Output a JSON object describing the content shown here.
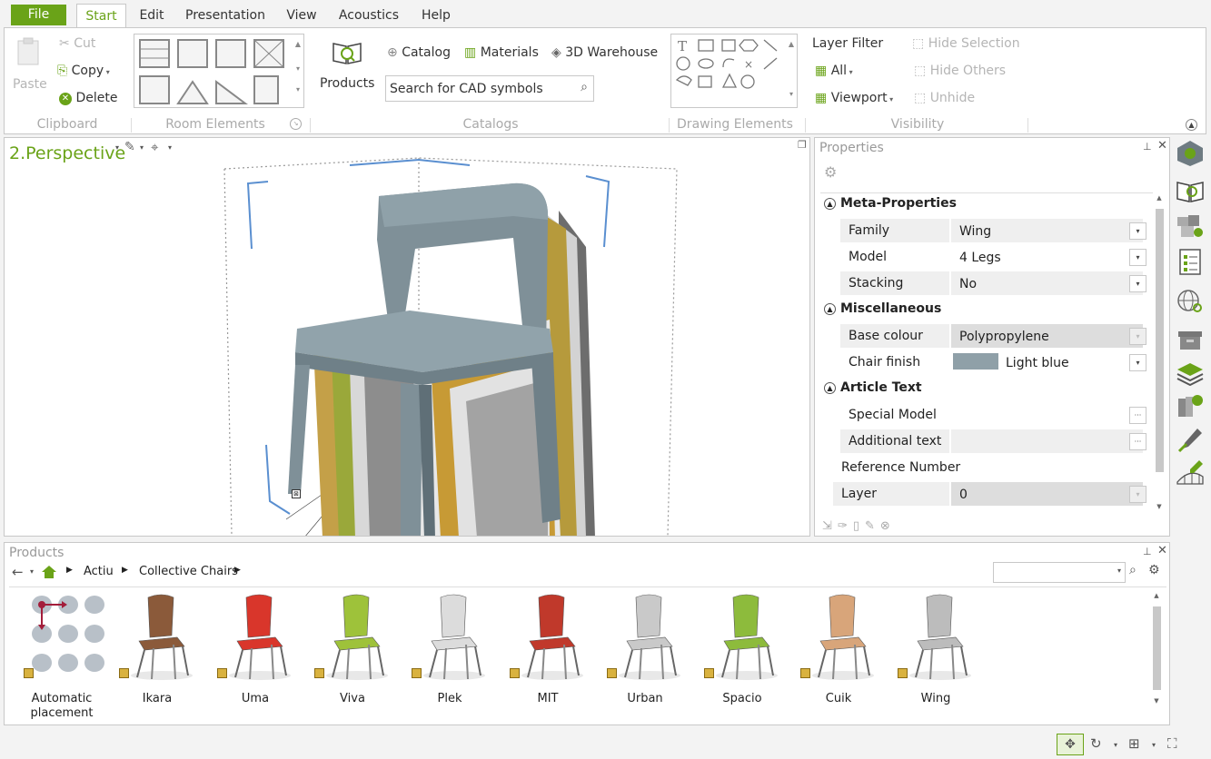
{
  "menu": {
    "file": "File",
    "tabs": [
      "Start",
      "Edit",
      "Presentation",
      "View",
      "Acoustics",
      "Help"
    ]
  },
  "ribbon": {
    "clipboard": {
      "paste": "Paste",
      "cut": "Cut",
      "copy": "Copy",
      "delete": "Delete",
      "label": "Clipboard"
    },
    "room_elements": {
      "label": "Room Elements"
    },
    "catalogs": {
      "products": "Products",
      "catalog": "Catalog",
      "materials": "Materials",
      "warehouse": "3D Warehouse",
      "search_placeholder": "Search for CAD symbols",
      "label": "Catalogs"
    },
    "drawing_elements": {
      "label": "Drawing Elements"
    },
    "visibility": {
      "layer_filter": "Layer Filter",
      "all": "All",
      "viewport": "Viewport",
      "hide_selection": "Hide Selection",
      "hide_others": "Hide Others",
      "unhide": "Unhide",
      "label": "Visibility"
    }
  },
  "viewport": {
    "title": "2.Perspective"
  },
  "properties": {
    "title": "Properties",
    "sections": {
      "meta": "Meta-Properties",
      "misc": "Miscellaneous",
      "article": "Article Text"
    },
    "rows": {
      "family": {
        "label": "Family",
        "value": "Wing"
      },
      "model": {
        "label": "Model",
        "value": "4 Legs"
      },
      "stacking": {
        "label": "Stacking",
        "value": "No"
      },
      "base_colour": {
        "label": "Base colour",
        "value": "Polypropylene"
      },
      "chair_finish": {
        "label": "Chair finish",
        "value": "Light blue",
        "swatch": "#8fa0a8"
      },
      "special_model": {
        "label": "Special Model I...",
        "value": ""
      },
      "additional_text": {
        "label": "Additional text",
        "value": ""
      },
      "reference_number": {
        "label": "Reference Number",
        "value": ""
      },
      "layer": {
        "label": "Layer",
        "value": "0"
      }
    }
  },
  "products": {
    "title": "Products",
    "breadcrumb": [
      "Actiu",
      "Collective Chairs"
    ],
    "items": [
      {
        "name": "Automatic placement",
        "color": "#b8c0c8"
      },
      {
        "name": "Ikara",
        "color": "#8b5a3a"
      },
      {
        "name": "Uma",
        "color": "#d9362b"
      },
      {
        "name": "Viva",
        "color": "#9ec23a"
      },
      {
        "name": "Plek",
        "color": "#dcdcdc"
      },
      {
        "name": "MIT",
        "color": "#c0392b"
      },
      {
        "name": "Urban",
        "color": "#c9c9c9"
      },
      {
        "name": "Spacio",
        "color": "#8dbb3c"
      },
      {
        "name": "Cuik",
        "color": "#d8a57a"
      },
      {
        "name": "Wing",
        "color": "#bcbcbc"
      }
    ]
  },
  "colors": {
    "accent": "#6aa318",
    "border": "#c8c8c8",
    "chair_blue": "#7f9098"
  }
}
